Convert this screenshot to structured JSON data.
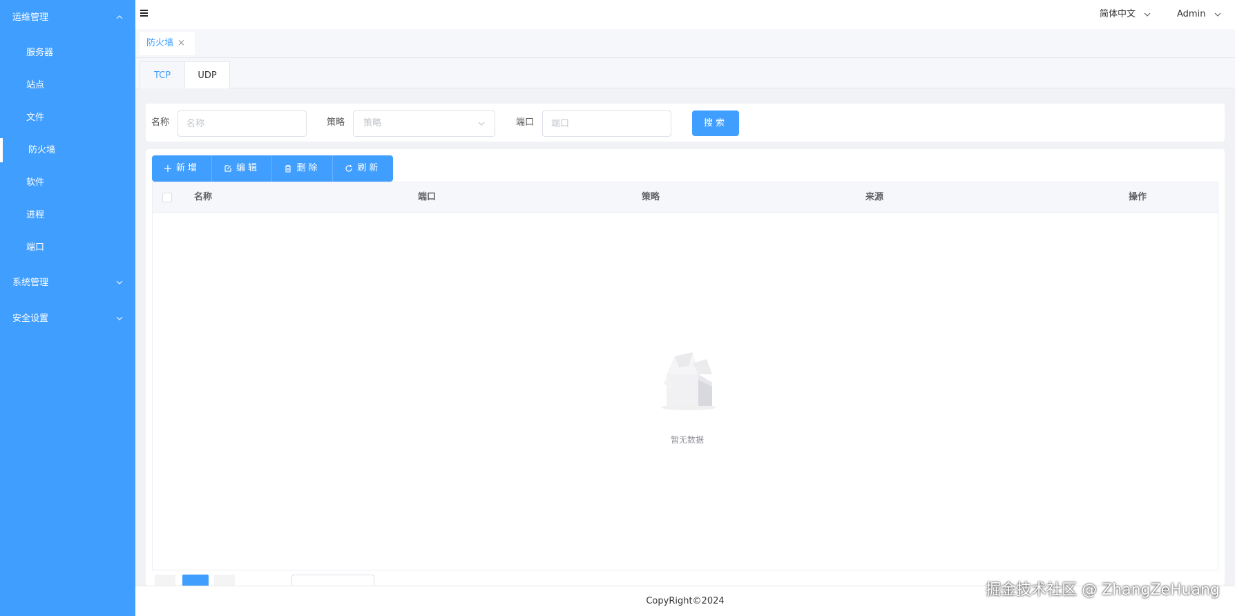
{
  "sidebar": {
    "groups": [
      {
        "label": "运维管理",
        "expanded": true,
        "items": [
          {
            "label": "服务器",
            "active": false
          },
          {
            "label": "站点",
            "active": false
          },
          {
            "label": "文件",
            "active": false
          },
          {
            "label": "防火墙",
            "active": true
          },
          {
            "label": "软件",
            "active": false
          },
          {
            "label": "进程",
            "active": false
          },
          {
            "label": "端口",
            "active": false
          }
        ]
      },
      {
        "label": "系统管理",
        "expanded": false
      },
      {
        "label": "安全设置",
        "expanded": false
      }
    ]
  },
  "header": {
    "language": "简体中文",
    "user": "Admin"
  },
  "tags": [
    {
      "label": "防火墙",
      "close": "×"
    }
  ],
  "protocol_tabs": [
    {
      "label": "TCP",
      "active": true
    },
    {
      "label": "UDP",
      "active": false
    }
  ],
  "search": {
    "name_label": "名称",
    "name_placeholder": "名称",
    "policy_label": "策略",
    "policy_placeholder": "策略",
    "port_label": "端口",
    "port_placeholder": "端口",
    "search_button": "搜索"
  },
  "toolbar": {
    "add": "新增",
    "edit": "编辑",
    "delete": "删除",
    "refresh": "刷新"
  },
  "table": {
    "columns": [
      "名称",
      "端口",
      "策略",
      "来源",
      "操作"
    ],
    "rows": [],
    "empty_text": "暂无数据"
  },
  "footer": {
    "copyright": "CopyRight©2024"
  },
  "watermark": "掘金技术社区 @ ZhangZeHuang",
  "colors": {
    "primary": "#409eff",
    "sidebar_bg": "#409eff",
    "page_bg": "#f0f2f5"
  }
}
